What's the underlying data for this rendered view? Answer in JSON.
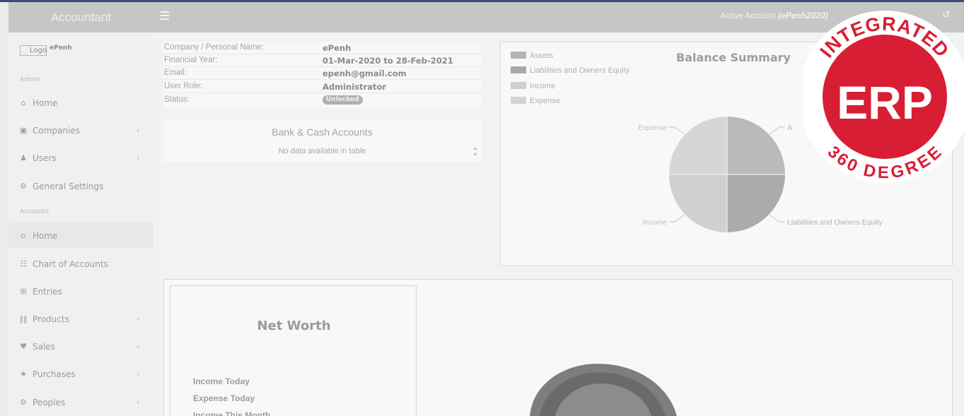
{
  "navbar": {
    "brand": "Accountant",
    "active_prefix": "Active Account ",
    "active_account": "(ePenh2020)"
  },
  "sidebar": {
    "logo_text": "Logo",
    "company": "ePenh",
    "sections": [
      "Admin",
      "Accounts"
    ],
    "admin_items": [
      {
        "label": "Home",
        "icon": "home-icon",
        "chevron": false
      },
      {
        "label": "Companies",
        "icon": "building-icon",
        "chevron": true
      },
      {
        "label": "Users",
        "icon": "users-icon",
        "chevron": true
      },
      {
        "label": "General Settings",
        "icon": "gears-icon",
        "chevron": false
      }
    ],
    "account_items": [
      {
        "label": "Home",
        "icon": "home-icon",
        "chevron": false,
        "active": true
      },
      {
        "label": "Chart of Accounts",
        "icon": "sitemap-icon",
        "chevron": false
      },
      {
        "label": "Entries",
        "icon": "plus-square-icon",
        "chevron": false
      },
      {
        "label": "Products",
        "icon": "barcode-icon",
        "chevron": true
      },
      {
        "label": "Sales",
        "icon": "heart-icon",
        "chevron": true
      },
      {
        "label": "Purchases",
        "icon": "star-icon",
        "chevron": true
      },
      {
        "label": "Peoples",
        "icon": "gear-icon",
        "chevron": true
      }
    ]
  },
  "info": {
    "rows": [
      {
        "key": "Company / Personal Name:",
        "value": "ePenh"
      },
      {
        "key": "Financial Year:",
        "value": "01-Mar-2020 to 28-Feb-2021"
      },
      {
        "key": "Email:",
        "value": "epenh@gmail.com"
      },
      {
        "key": "User Role:",
        "value": "Administrator"
      },
      {
        "key": "Status:",
        "value": "Unlocked"
      }
    ]
  },
  "bank": {
    "title": "Bank & Cash Accounts",
    "empty": "No data available in table"
  },
  "balance": {
    "title": "Balance Summary",
    "legend": [
      {
        "label": "Assets",
        "color": "#b5b5b5"
      },
      {
        "label": "Liabilities and Owners Equity",
        "color": "#a8a8a8"
      },
      {
        "label": "Income",
        "color": "#cfcfcf"
      },
      {
        "label": "Expense",
        "color": "#d3d3d3"
      }
    ],
    "pie_labels": {
      "assets": "A",
      "liabilities": "Liabilities and Owners Equity",
      "income": "Income",
      "expense": "Expense"
    }
  },
  "networth": {
    "title": "Net Worth",
    "items": [
      "Income Today",
      "Expense Today",
      "Income This Month"
    ]
  },
  "erp_badge": {
    "top": "INTEGRATED",
    "center": "ERP",
    "bottom": "360 DEGREE",
    "color": "#d81e34"
  }
}
